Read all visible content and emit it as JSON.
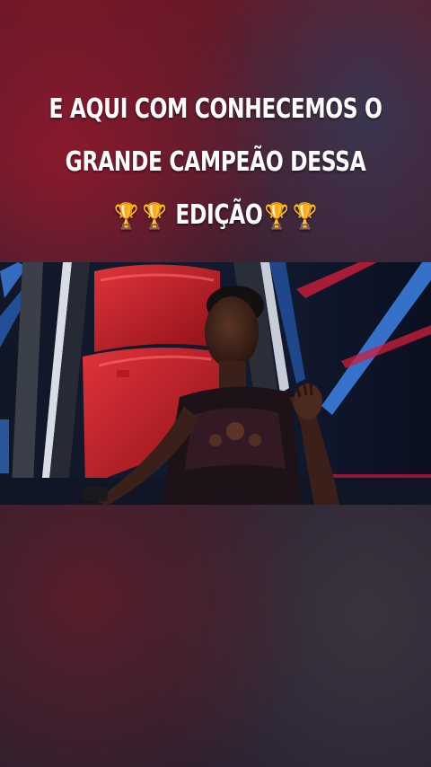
{
  "caption": {
    "line1": "E AQUI COM CONHECEMOS O",
    "line2": "GRANDE CAMPEÃO DESSA",
    "line3_text": "EDIÇÃO",
    "trophy_glyph": "🏆"
  },
  "video": {
    "description_icon": "video-frame"
  },
  "colors": {
    "caption_text": "#ffffff",
    "chair_red": "#c8202a",
    "stage_blue": "#3a7ad8",
    "stage_pink": "#d8204a"
  }
}
